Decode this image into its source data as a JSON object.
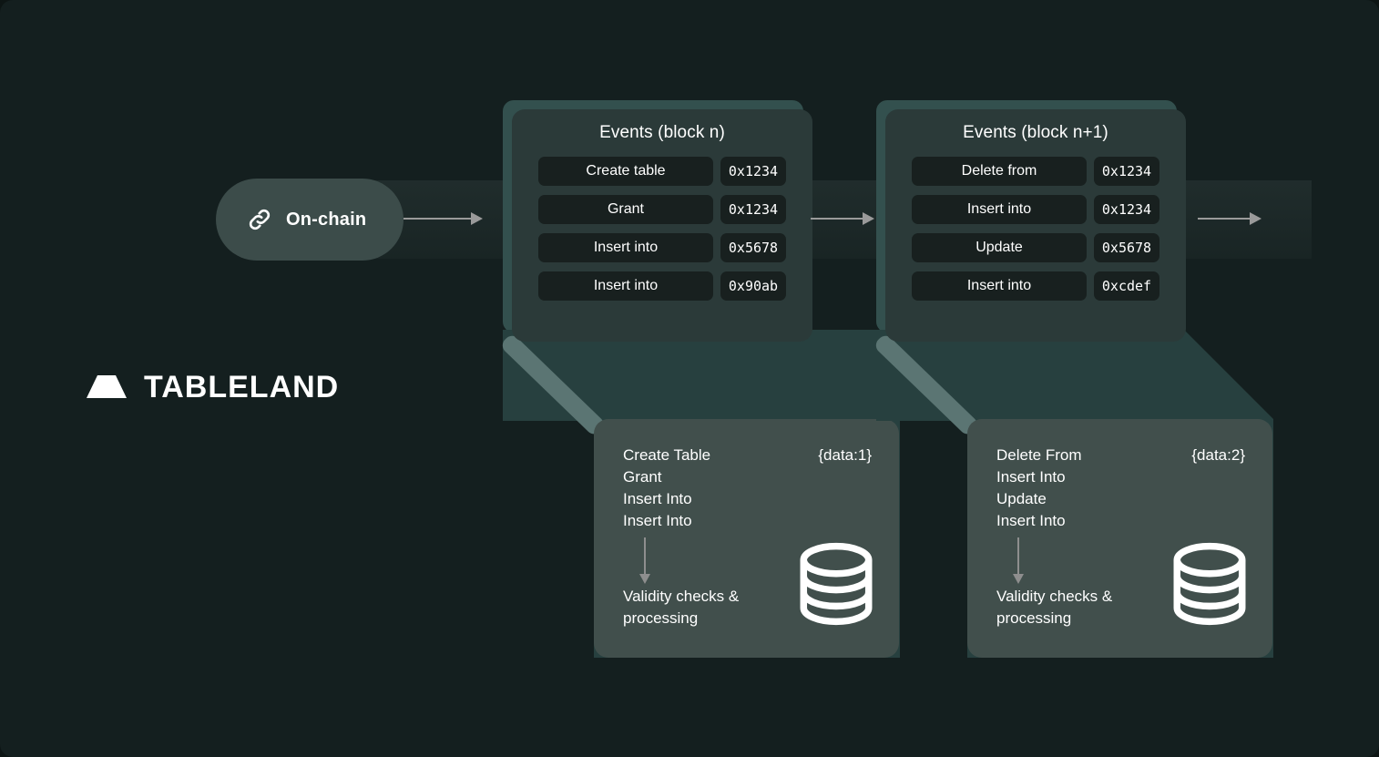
{
  "background_color": "#141f1f",
  "logo": {
    "name": "TABLELAND",
    "mark_icon": "tableland-mesa-icon"
  },
  "onchain": {
    "label": "On-chain",
    "icon": "link-icon"
  },
  "arrows": {
    "icon": "arrow-right-icon"
  },
  "blocks": [
    {
      "events": {
        "title": "Events (block n)",
        "rows": [
          {
            "name": "Create table",
            "hash": "0x1234"
          },
          {
            "name": "Grant",
            "hash": "0x1234"
          },
          {
            "name": "Insert into",
            "hash": "0x5678"
          },
          {
            "name": "Insert into",
            "hash": "0x90ab"
          }
        ]
      },
      "processing": {
        "data_label": "{data:1}",
        "operations": [
          "Create Table",
          "Grant",
          "Insert Into",
          "Insert Into"
        ],
        "footer": "Validity checks & processing",
        "db_icon": "database-icon",
        "arrow_icon": "arrow-down-icon"
      }
    },
    {
      "events": {
        "title": "Events (block n+1)",
        "rows": [
          {
            "name": "Delete from",
            "hash": "0x1234"
          },
          {
            "name": "Insert into",
            "hash": "0x1234"
          },
          {
            "name": "Update",
            "hash": "0x5678"
          },
          {
            "name": "Insert into",
            "hash": "0xcdef"
          }
        ]
      },
      "processing": {
        "data_label": "{data:2}",
        "operations": [
          "Delete From",
          "Insert Into",
          "Update",
          "Insert Into"
        ],
        "footer": "Validity checks & processing",
        "db_icon": "database-icon",
        "arrow_icon": "arrow-down-icon"
      }
    }
  ],
  "colors": {
    "background": "#141f1f",
    "events_card": "#2b3a39",
    "processing_card": "#414f4c",
    "mid_layer": "#27403f",
    "diagonal_band": "#5b7573",
    "pill": "#3c4c4a",
    "chip": "#18201f",
    "arrow": "#9a9a9a",
    "text": "#ffffff"
  }
}
